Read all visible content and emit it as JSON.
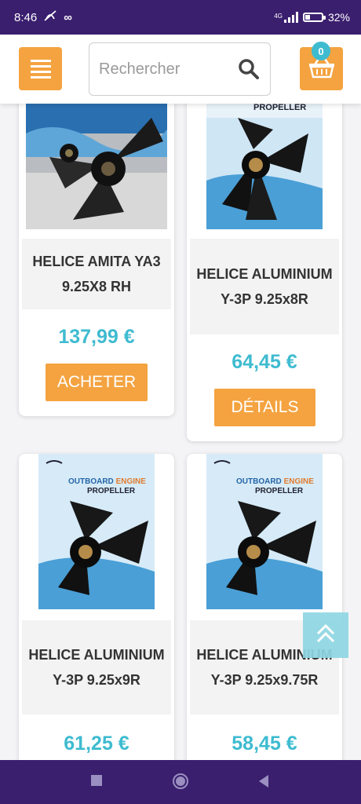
{
  "status_bar": {
    "time": "8:46",
    "battery": "32%",
    "network": "4G",
    "battery_level": 0.32
  },
  "header": {
    "search_placeholder": "Rechercher",
    "cart_count": "0",
    "icons": {
      "menu": "hamburger-icon",
      "search": "search-icon",
      "cart": "basket-icon"
    }
  },
  "products": [
    {
      "name": "HELICE AMITA YA3 9.25X8 RH",
      "price": "137,99 €",
      "button": "ACHETER"
    },
    {
      "name": "HELICE ALUMINIUM Y-3P 9.25x8R",
      "price": "64,45 €",
      "button": "DÉTAILS",
      "image_text": "PROPELLER"
    },
    {
      "name": "HELICE ALUMINIUM Y-3P 9.25x9R",
      "price": "61,25 €",
      "image_text_1": "OUTBOARD ENGINE",
      "image_text_2": "PROPELLER"
    },
    {
      "name": "HELICE ALUMINIUM Y-3P 9.25x9.75R",
      "price": "58,45 €",
      "image_text_1": "OUTBOARD ENGINE",
      "image_text_2": "PROPELLER"
    }
  ],
  "colors": {
    "brand_purple": "#3a1f6e",
    "accent_orange": "#f4a340",
    "price_teal": "#3ebbd0"
  }
}
